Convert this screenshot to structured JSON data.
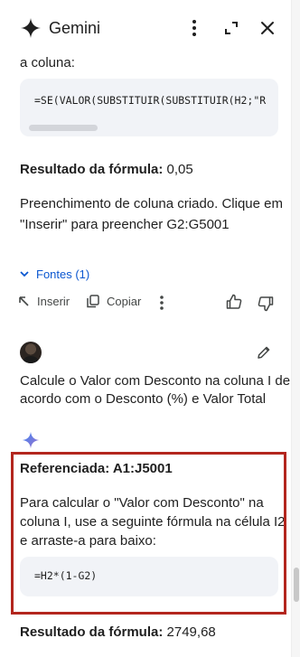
{
  "header": {
    "title": "Gemini",
    "icons": {
      "logo": "gemini-sparkle-icon",
      "more": "more-vert-icon",
      "expand": "open-full-icon",
      "close": "close-icon"
    }
  },
  "response1": {
    "intro_tail": "a coluna:",
    "code": "=SE(VALOR(SUBSTITUIR(SUBSTITUIR(H2;\"R",
    "result_label": "Resultado da fórmula:",
    "result_value": "0,05",
    "message_line1": "Preenchimento de coluna criado. Clique em",
    "message_line2": "\"Inserir\" para preencher G2:G5001",
    "sources_label": "Fontes (1)",
    "actions": {
      "insert": "Inserir",
      "copy": "Copiar"
    }
  },
  "user_prompt": {
    "line1": "Calcule o Valor com Desconto na coluna I de",
    "line2": "acordo com o Desconto (%) e Valor Total"
  },
  "response2": {
    "referenced_label": "Referenciada: A1:J5001",
    "line1": "Para calcular o \"Valor com Desconto\" na",
    "line2": "coluna I, use a seguinte fórmula na célula I2",
    "line3": "e arraste-a para baixo:",
    "code": "=H2*(1-G2)",
    "result_label": "Resultado da fórmula:",
    "result_value": "2749,68"
  },
  "colors": {
    "accent_blue": "#0b57d0",
    "highlight_red": "#b3261e",
    "code_bg": "#f1f3f7"
  }
}
